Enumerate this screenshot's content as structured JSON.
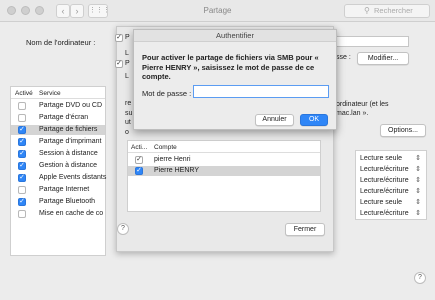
{
  "window": {
    "title": "Partage",
    "search_placeholder": "Rechercher"
  },
  "main": {
    "computer_name_label": "Nom de l'ordinateur :",
    "edit_suffix": "sse :",
    "edit_button": "Modifier...",
    "right_text_1": "ordinateur (et les",
    "right_text_2": "mac.lan ».",
    "options_button": "Options...",
    "help": "?"
  },
  "services": {
    "header_enabled": "Activé",
    "header_service": "Service",
    "items": [
      {
        "label": "Partage DVD ou CD",
        "checked": false
      },
      {
        "label": "Partage d'écran",
        "checked": false
      },
      {
        "label": "Partage de fichiers",
        "checked": true,
        "selected": true
      },
      {
        "label": "Partage d'imprimant",
        "checked": true
      },
      {
        "label": "Session à distance",
        "checked": true
      },
      {
        "label": "Gestion à distance",
        "checked": true
      },
      {
        "label": "Apple Events distants",
        "checked": true
      },
      {
        "label": "Partage Internet",
        "checked": false
      },
      {
        "label": "Partage Bluetooth",
        "checked": true
      },
      {
        "label": "Mise en cache de co",
        "checked": false
      }
    ]
  },
  "permissions": [
    "Lecture seule",
    "Lecture/écriture",
    "Lecture/écriture",
    "Lecture/écriture",
    "Lecture seule",
    "Lecture/écriture"
  ],
  "sheet": {
    "header_active": "Acti...",
    "header_account": "Compte",
    "accounts": [
      {
        "label": "pierre Henri",
        "checked": true
      },
      {
        "label": "Pierre HENRY",
        "checked": true,
        "selected": true
      }
    ],
    "close_button": "Fermer",
    "help": "?",
    "fragments": [
      "P",
      "L",
      "P",
      "L",
      "re",
      "su",
      "ut",
      "o"
    ]
  },
  "auth": {
    "title": "Authentifier",
    "message": "Pour activer le partage de fichiers via SMB pour « Pierre HENRY », saisissez le mot de passe de ce compte.",
    "password_label": "Mot de passe :",
    "password_value": "",
    "cancel_button": "Annuler",
    "ok_button": "OK"
  },
  "icons": {
    "back": "chevron-left-icon",
    "forward": "chevron-right-icon",
    "grid": "grid-icon",
    "search": "search-icon",
    "check": "checkmark-icon"
  },
  "colors": {
    "accent": "#2f86f7",
    "selection": "#d4d4d4"
  }
}
